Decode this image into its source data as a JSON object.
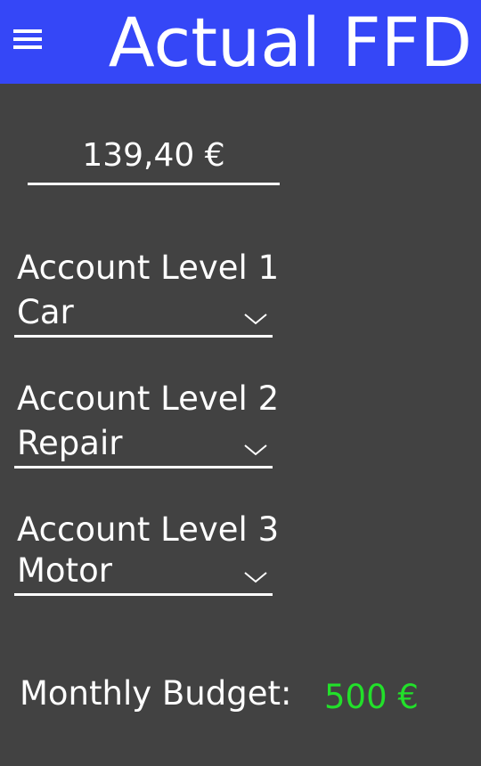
{
  "header": {
    "title": "Actual FFD",
    "menu_icon": "hamburger-menu-icon"
  },
  "amount": {
    "value": "139,40 €"
  },
  "fields": [
    {
      "label": "Account Level 1",
      "value": "Car",
      "icon": "chevron-down-icon"
    },
    {
      "label": "Account Level 2",
      "value": "Repair",
      "icon": "chevron-down-icon"
    },
    {
      "label": "Account Level 3",
      "value": "Motor",
      "icon": "chevron-down-icon"
    }
  ],
  "budget": {
    "label": "Monthly Budget:",
    "value": "500 €"
  },
  "colors": {
    "header_bg": "#3547f7",
    "page_bg": "#424242",
    "text": "#ffffff",
    "budget_value": "#22e02a"
  }
}
